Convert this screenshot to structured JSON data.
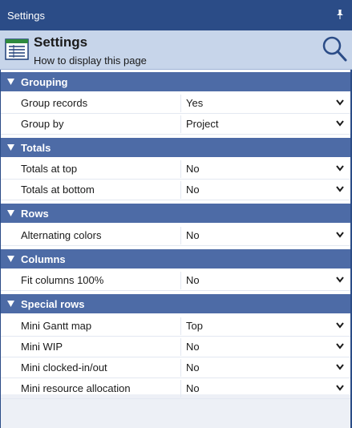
{
  "window": {
    "title": "Settings",
    "pin_icon": "pin-icon"
  },
  "header": {
    "title": "Settings",
    "subtitle": "How to display this page",
    "doc_icon": "document-grid-icon",
    "search_icon": "search-icon"
  },
  "sections": [
    {
      "title": "Grouping",
      "rows": [
        {
          "label": "Group records",
          "value": "Yes"
        },
        {
          "label": "Group by",
          "value": "Project"
        }
      ]
    },
    {
      "title": "Totals",
      "rows": [
        {
          "label": "Totals at top",
          "value": "No"
        },
        {
          "label": "Totals at bottom",
          "value": "No"
        }
      ]
    },
    {
      "title": "Rows",
      "rows": [
        {
          "label": "Alternating colors",
          "value": "No"
        }
      ]
    },
    {
      "title": "Columns",
      "rows": [
        {
          "label": "Fit columns 100%",
          "value": "No"
        }
      ]
    },
    {
      "title": "Special rows",
      "rows": [
        {
          "label": "Mini Gantt map",
          "value": "Top"
        },
        {
          "label": "Mini WIP",
          "value": "No"
        },
        {
          "label": "Mini clocked-in/out",
          "value": "No"
        },
        {
          "label": "Mini resource allocation",
          "value": "No"
        }
      ]
    }
  ],
  "colors": {
    "titlebar": "#2b4c87",
    "header": "#c7d5ea",
    "section": "#4d6ba6"
  }
}
